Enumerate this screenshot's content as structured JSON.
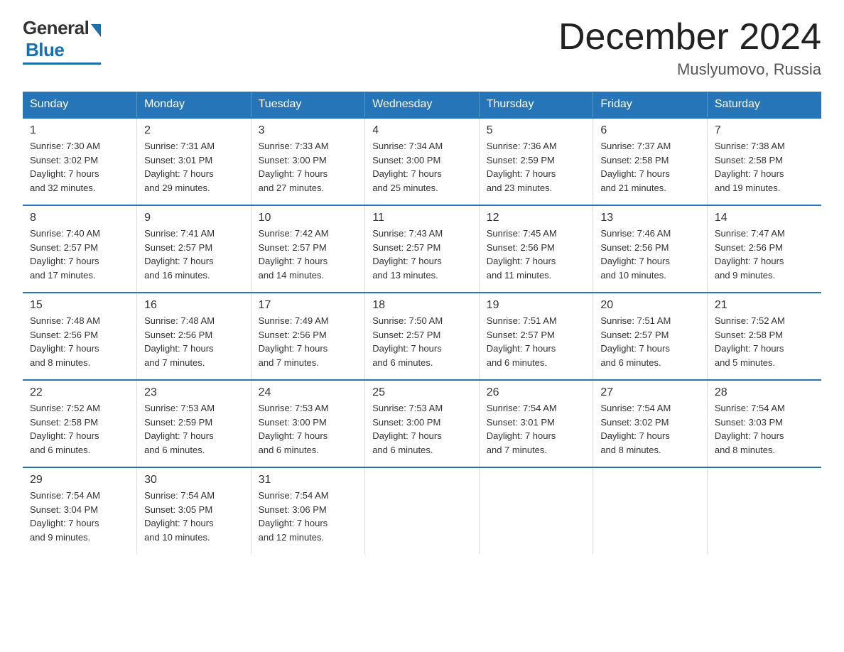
{
  "logo": {
    "general": "General",
    "blue": "Blue"
  },
  "title": "December 2024",
  "subtitle": "Muslyumovo, Russia",
  "days_header": [
    "Sunday",
    "Monday",
    "Tuesday",
    "Wednesday",
    "Thursday",
    "Friday",
    "Saturday"
  ],
  "weeks": [
    [
      {
        "day": "1",
        "info": "Sunrise: 7:30 AM\nSunset: 3:02 PM\nDaylight: 7 hours\nand 32 minutes."
      },
      {
        "day": "2",
        "info": "Sunrise: 7:31 AM\nSunset: 3:01 PM\nDaylight: 7 hours\nand 29 minutes."
      },
      {
        "day": "3",
        "info": "Sunrise: 7:33 AM\nSunset: 3:00 PM\nDaylight: 7 hours\nand 27 minutes."
      },
      {
        "day": "4",
        "info": "Sunrise: 7:34 AM\nSunset: 3:00 PM\nDaylight: 7 hours\nand 25 minutes."
      },
      {
        "day": "5",
        "info": "Sunrise: 7:36 AM\nSunset: 2:59 PM\nDaylight: 7 hours\nand 23 minutes."
      },
      {
        "day": "6",
        "info": "Sunrise: 7:37 AM\nSunset: 2:58 PM\nDaylight: 7 hours\nand 21 minutes."
      },
      {
        "day": "7",
        "info": "Sunrise: 7:38 AM\nSunset: 2:58 PM\nDaylight: 7 hours\nand 19 minutes."
      }
    ],
    [
      {
        "day": "8",
        "info": "Sunrise: 7:40 AM\nSunset: 2:57 PM\nDaylight: 7 hours\nand 17 minutes."
      },
      {
        "day": "9",
        "info": "Sunrise: 7:41 AM\nSunset: 2:57 PM\nDaylight: 7 hours\nand 16 minutes."
      },
      {
        "day": "10",
        "info": "Sunrise: 7:42 AM\nSunset: 2:57 PM\nDaylight: 7 hours\nand 14 minutes."
      },
      {
        "day": "11",
        "info": "Sunrise: 7:43 AM\nSunset: 2:57 PM\nDaylight: 7 hours\nand 13 minutes."
      },
      {
        "day": "12",
        "info": "Sunrise: 7:45 AM\nSunset: 2:56 PM\nDaylight: 7 hours\nand 11 minutes."
      },
      {
        "day": "13",
        "info": "Sunrise: 7:46 AM\nSunset: 2:56 PM\nDaylight: 7 hours\nand 10 minutes."
      },
      {
        "day": "14",
        "info": "Sunrise: 7:47 AM\nSunset: 2:56 PM\nDaylight: 7 hours\nand 9 minutes."
      }
    ],
    [
      {
        "day": "15",
        "info": "Sunrise: 7:48 AM\nSunset: 2:56 PM\nDaylight: 7 hours\nand 8 minutes."
      },
      {
        "day": "16",
        "info": "Sunrise: 7:48 AM\nSunset: 2:56 PM\nDaylight: 7 hours\nand 7 minutes."
      },
      {
        "day": "17",
        "info": "Sunrise: 7:49 AM\nSunset: 2:56 PM\nDaylight: 7 hours\nand 7 minutes."
      },
      {
        "day": "18",
        "info": "Sunrise: 7:50 AM\nSunset: 2:57 PM\nDaylight: 7 hours\nand 6 minutes."
      },
      {
        "day": "19",
        "info": "Sunrise: 7:51 AM\nSunset: 2:57 PM\nDaylight: 7 hours\nand 6 minutes."
      },
      {
        "day": "20",
        "info": "Sunrise: 7:51 AM\nSunset: 2:57 PM\nDaylight: 7 hours\nand 6 minutes."
      },
      {
        "day": "21",
        "info": "Sunrise: 7:52 AM\nSunset: 2:58 PM\nDaylight: 7 hours\nand 5 minutes."
      }
    ],
    [
      {
        "day": "22",
        "info": "Sunrise: 7:52 AM\nSunset: 2:58 PM\nDaylight: 7 hours\nand 6 minutes."
      },
      {
        "day": "23",
        "info": "Sunrise: 7:53 AM\nSunset: 2:59 PM\nDaylight: 7 hours\nand 6 minutes."
      },
      {
        "day": "24",
        "info": "Sunrise: 7:53 AM\nSunset: 3:00 PM\nDaylight: 7 hours\nand 6 minutes."
      },
      {
        "day": "25",
        "info": "Sunrise: 7:53 AM\nSunset: 3:00 PM\nDaylight: 7 hours\nand 6 minutes."
      },
      {
        "day": "26",
        "info": "Sunrise: 7:54 AM\nSunset: 3:01 PM\nDaylight: 7 hours\nand 7 minutes."
      },
      {
        "day": "27",
        "info": "Sunrise: 7:54 AM\nSunset: 3:02 PM\nDaylight: 7 hours\nand 8 minutes."
      },
      {
        "day": "28",
        "info": "Sunrise: 7:54 AM\nSunset: 3:03 PM\nDaylight: 7 hours\nand 8 minutes."
      }
    ],
    [
      {
        "day": "29",
        "info": "Sunrise: 7:54 AM\nSunset: 3:04 PM\nDaylight: 7 hours\nand 9 minutes."
      },
      {
        "day": "30",
        "info": "Sunrise: 7:54 AM\nSunset: 3:05 PM\nDaylight: 7 hours\nand 10 minutes."
      },
      {
        "day": "31",
        "info": "Sunrise: 7:54 AM\nSunset: 3:06 PM\nDaylight: 7 hours\nand 12 minutes."
      },
      {
        "day": "",
        "info": ""
      },
      {
        "day": "",
        "info": ""
      },
      {
        "day": "",
        "info": ""
      },
      {
        "day": "",
        "info": ""
      }
    ]
  ]
}
